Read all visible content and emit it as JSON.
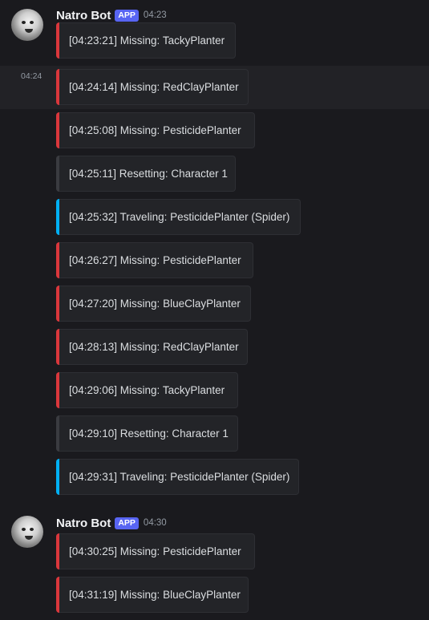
{
  "colors": {
    "background": "#1a1a1e",
    "missing": "#da373c",
    "resetting": "#3a3b40",
    "traveling": "#00b0f4",
    "app_badge": "#5865f2"
  },
  "groups": [
    {
      "username": "Natro Bot",
      "badge": "APP",
      "time": "04:23",
      "messages": [
        {
          "text": "[04:23:21] Missing: TackyPlanter",
          "kind": "missing",
          "side_time": ""
        },
        {
          "text": "[04:24:14] Missing: RedClayPlanter",
          "kind": "missing",
          "side_time": "04:24"
        },
        {
          "text": "[04:25:08] Missing: PesticidePlanter",
          "kind": "missing",
          "side_time": ""
        },
        {
          "text": "[04:25:11] Resetting: Character 1",
          "kind": "resetting",
          "side_time": ""
        },
        {
          "text": "[04:25:32] Traveling: PesticidePlanter (Spider)",
          "kind": "traveling",
          "side_time": ""
        },
        {
          "text": "[04:26:27] Missing: PesticidePlanter",
          "kind": "missing",
          "side_time": ""
        },
        {
          "text": "[04:27:20] Missing: BlueClayPlanter",
          "kind": "missing",
          "side_time": ""
        },
        {
          "text": "[04:28:13] Missing: RedClayPlanter",
          "kind": "missing",
          "side_time": ""
        },
        {
          "text": "[04:29:06] Missing: TackyPlanter",
          "kind": "missing",
          "side_time": ""
        },
        {
          "text": "[04:29:10] Resetting: Character 1",
          "kind": "resetting",
          "side_time": ""
        },
        {
          "text": "[04:29:31] Traveling: PesticidePlanter (Spider)",
          "kind": "traveling",
          "side_time": ""
        }
      ]
    },
    {
      "username": "Natro Bot",
      "badge": "APP",
      "time": "04:30",
      "messages": [
        {
          "text": "[04:30:25] Missing: PesticidePlanter",
          "kind": "missing",
          "side_time": ""
        },
        {
          "text": "[04:31:19] Missing: BlueClayPlanter",
          "kind": "missing",
          "side_time": ""
        }
      ]
    }
  ]
}
